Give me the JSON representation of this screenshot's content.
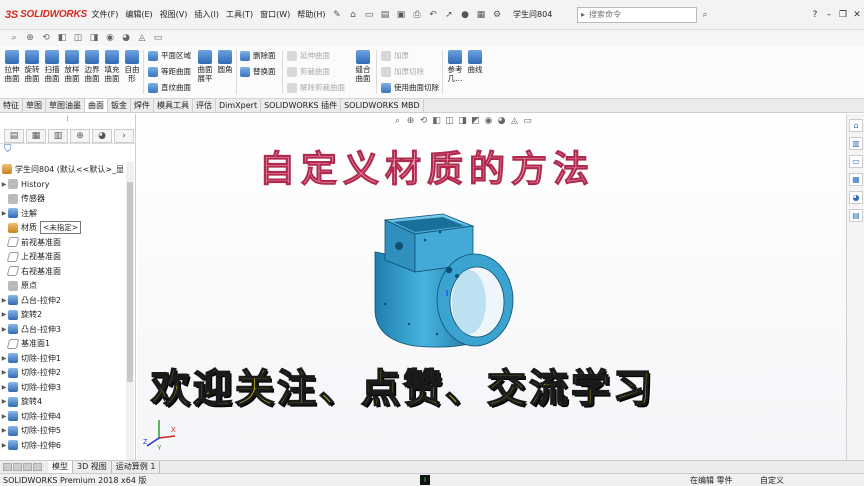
{
  "app": {
    "logo_ds": "3S",
    "logo_text": "SOLIDWORKS",
    "document_name": "学生问804"
  },
  "menu": [
    "文件(F)",
    "编辑(E)",
    "视图(V)",
    "插入(I)",
    "工具(T)",
    "窗口(W)",
    "帮助(H)"
  ],
  "search": {
    "placeholder": "搜索命令"
  },
  "ribbon": {
    "big_buttons": [
      {
        "line1": "拉伸",
        "line2": "曲面"
      },
      {
        "line1": "旋转",
        "line2": "曲面"
      },
      {
        "line1": "扫描",
        "line2": "曲面"
      },
      {
        "line1": "放样",
        "line2": "曲面"
      },
      {
        "line1": "边界",
        "line2": "曲面"
      },
      {
        "line1": "填充",
        "line2": "曲面"
      },
      {
        "line1": "自由",
        "line2": "形"
      }
    ],
    "group1": [
      "平面区域",
      "等距曲面",
      "直纹曲面"
    ],
    "flatten": {
      "line1": "曲面",
      "line2": "展平"
    },
    "fillet": "圆角",
    "group2": [
      "删除面",
      "替换面"
    ],
    "group3": [
      "延伸曲面",
      "剪裁曲面",
      "解除剪裁曲面"
    ],
    "knit": {
      "line1": "缝合",
      "line2": "曲面"
    },
    "group4": [
      "加厚",
      "加厚切除",
      "使用曲面切除"
    ],
    "reference": {
      "line1": "参考",
      "line2": "几..."
    },
    "curves": "曲线"
  },
  "tabs": [
    {
      "label": "特征"
    },
    {
      "label": "草图"
    },
    {
      "label": "草图油墨"
    },
    {
      "label": "曲面",
      "active": true
    },
    {
      "label": "钣金"
    },
    {
      "label": "焊件"
    },
    {
      "label": "模具工具"
    },
    {
      "label": "评估"
    },
    {
      "label": "DimXpert"
    },
    {
      "label": "SOLIDWORKS 插件"
    },
    {
      "label": "SOLIDWORKS MBD"
    }
  ],
  "tree": {
    "root": "学生问804 (默认<<默认>_显",
    "items": [
      {
        "label": "History",
        "icon": "history-icon",
        "cls": "gray",
        "arrow": true
      },
      {
        "label": "传感器",
        "icon": "sensor-icon",
        "cls": "gray",
        "arrow": false
      },
      {
        "label": "注解",
        "icon": "annotation-icon",
        "cls": "blue",
        "arrow": true
      },
      {
        "label": "材质",
        "icon": "material-icon",
        "cls": "orange",
        "arrow": false,
        "material_value": "<未指定>"
      },
      {
        "label": "前视基准面",
        "icon": "plane-icon",
        "cls": "plane",
        "arrow": false
      },
      {
        "label": "上视基准面",
        "icon": "plane-icon",
        "cls": "plane",
        "arrow": false
      },
      {
        "label": "右视基准面",
        "icon": "plane-icon",
        "cls": "plane",
        "arrow": false
      },
      {
        "label": "原点",
        "icon": "origin-icon",
        "cls": "gray",
        "arrow": false
      },
      {
        "label": "凸台-拉伸2",
        "icon": "extrude-boss-icon",
        "cls": "blue",
        "arrow": true
      },
      {
        "label": "旋转2",
        "icon": "revolve-icon",
        "cls": "blue",
        "arrow": true
      },
      {
        "label": "凸台-拉伸3",
        "icon": "extrude-boss-icon",
        "cls": "blue",
        "arrow": true
      },
      {
        "label": "基准面1",
        "icon": "plane-icon",
        "cls": "plane",
        "arrow": false
      },
      {
        "label": "切除-拉伸1",
        "icon": "extrude-cut-icon",
        "cls": "blue",
        "arrow": true
      },
      {
        "label": "切除-拉伸2",
        "icon": "extrude-cut-icon",
        "cls": "blue",
        "arrow": true
      },
      {
        "label": "切除-拉伸3",
        "icon": "extrude-cut-icon",
        "cls": "blue",
        "arrow": true
      },
      {
        "label": "旋转4",
        "icon": "revolve-icon",
        "cls": "blue",
        "arrow": true
      },
      {
        "label": "切除-拉伸4",
        "icon": "extrude-cut-icon",
        "cls": "blue",
        "arrow": true
      },
      {
        "label": "切除-拉伸5",
        "icon": "extrude-cut-icon",
        "cls": "blue",
        "arrow": true
      },
      {
        "label": "切除-拉伸6",
        "icon": "extrude-cut-icon",
        "cls": "blue",
        "arrow": true
      }
    ]
  },
  "viewport": {
    "title_overlay": "自定义材质的方法",
    "subtitle_overlay": "欢迎关注、点赞、交流学习",
    "part_color": "#3aa3d0"
  },
  "triad": {
    "x": "X",
    "y": "Y",
    "z": "Z"
  },
  "bottom_tabs": [
    {
      "label": "模型",
      "active": true
    },
    {
      "label": "3D 视图"
    },
    {
      "label": "运动算例 1"
    }
  ],
  "status": {
    "left": "SOLIDWORKS Premium 2018 x64 版",
    "cursor": "I",
    "mode": "在编辑 零件",
    "units": "自定义"
  }
}
